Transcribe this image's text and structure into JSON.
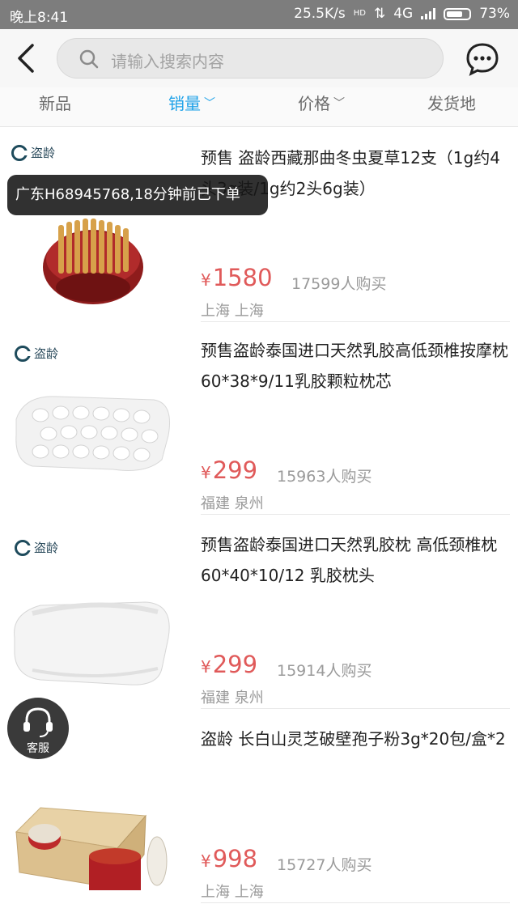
{
  "status_bar": {
    "time": "晚上8:41",
    "speed": "25.5K/s",
    "network": "4G",
    "battery": "73%",
    "battery_level": 0.73
  },
  "header": {
    "search_placeholder": "请输入搜索内容"
  },
  "tabs": [
    {
      "label": "新品"
    },
    {
      "label": "销量",
      "active": true
    },
    {
      "label": "价格"
    },
    {
      "label": "发货地"
    }
  ],
  "brand": "盗龄",
  "toast": "广东H68945768,18分钟前已下单",
  "service_label": "客服",
  "colors": {
    "accent": "#1aa0e8",
    "price": "#e05a5a",
    "status_bar": "#7d7d7d"
  },
  "products": [
    {
      "title": "预售 盗龄西藏那曲冬虫夏草12支（1g约4头3g装/1g约2头6g装）",
      "currency": "¥",
      "price": "1580",
      "sold": "17599人购买",
      "location": "上海 上海",
      "image_icon": "cordyceps-image"
    },
    {
      "title": "预售盗龄泰国进口天然乳胶高低颈椎按摩枕60*38*9/11乳胶颗粒枕芯",
      "currency": "¥",
      "price": "299",
      "sold": "15963人购买",
      "location": "福建 泉州",
      "image_icon": "massage-pillow-image"
    },
    {
      "title": "预售盗龄泰国进口天然乳胶枕 高低颈椎枕60*40*10/12 乳胶枕头",
      "currency": "¥",
      "price": "299",
      "sold": "15914人购买",
      "location": "福建 泉州",
      "image_icon": "latex-pillow-image"
    },
    {
      "title": "盗龄 长白山灵芝破壁孢子粉3g*20包/盒*2",
      "currency": "¥",
      "price": "998",
      "sold": "15727人购买",
      "location": "上海 上海",
      "image_icon": "ganoderma-box-image"
    }
  ]
}
